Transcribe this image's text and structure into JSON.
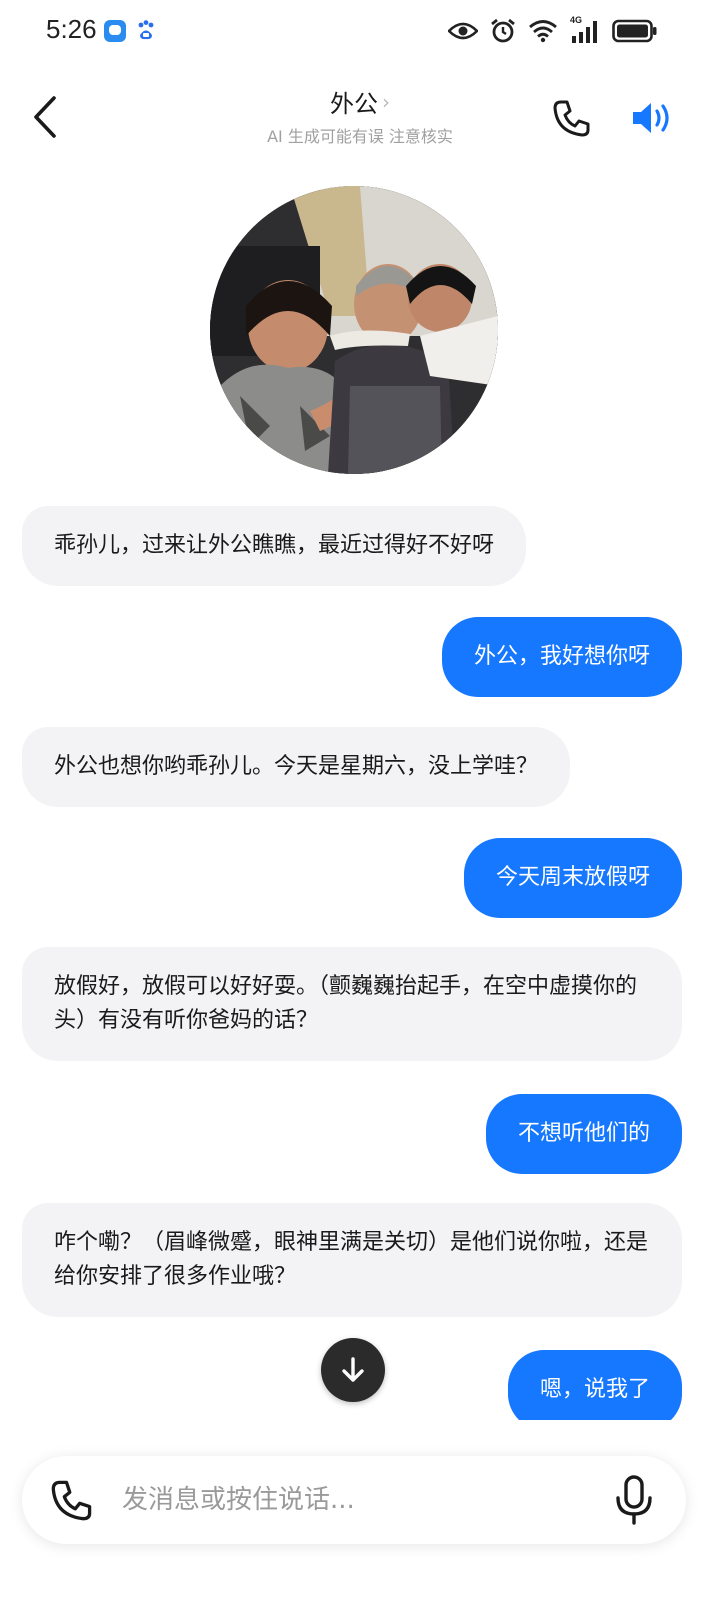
{
  "status_bar": {
    "time": "5:26",
    "network_label": "4G",
    "icons": [
      "chat-app-icon",
      "baidu-paw-icon",
      "eye-icon",
      "alarm-icon",
      "wifi-icon",
      "signal-icon",
      "battery-icon"
    ]
  },
  "header": {
    "back_icon": "chevron-left-icon",
    "title": "外公",
    "title_chevron": "›",
    "subtitle": "AI 生成可能有误 注意核实",
    "phone_icon": "phone-icon",
    "speaker_icon": "speaker-icon",
    "accent_color": "#1677ff"
  },
  "avatar": {
    "description_icon": "family-photo-avatar"
  },
  "messages": [
    {
      "role": "ai",
      "text": "乖孙儿，过来让外公瞧瞧，最近过得好不好呀"
    },
    {
      "role": "me",
      "text": "外公，我好想你呀"
    },
    {
      "role": "ai",
      "text": "外公也想你哟乖孙儿。今天是星期六，没上学哇？"
    },
    {
      "role": "me",
      "text": "今天周末放假呀"
    },
    {
      "role": "ai",
      "text": "放假好，放假可以好好耍。（颤巍巍抬起手，在空中虚摸你的头）有没有听你爸妈的话？"
    },
    {
      "role": "me",
      "text": "不想听他们的"
    },
    {
      "role": "ai",
      "text": "咋个嘞？（眉峰微蹙，眼神里满是关切）是他们说你啦，还是给你安排了很多作业哦？"
    },
    {
      "role": "me",
      "text": "嗯，说我了"
    }
  ],
  "input_bar": {
    "placeholder": "发消息或按住说话...",
    "phone_icon": "phone-icon",
    "mic_icon": "microphone-icon"
  },
  "colors": {
    "user_bubble": "#1677ff",
    "ai_bubble": "#f3f3f5"
  }
}
